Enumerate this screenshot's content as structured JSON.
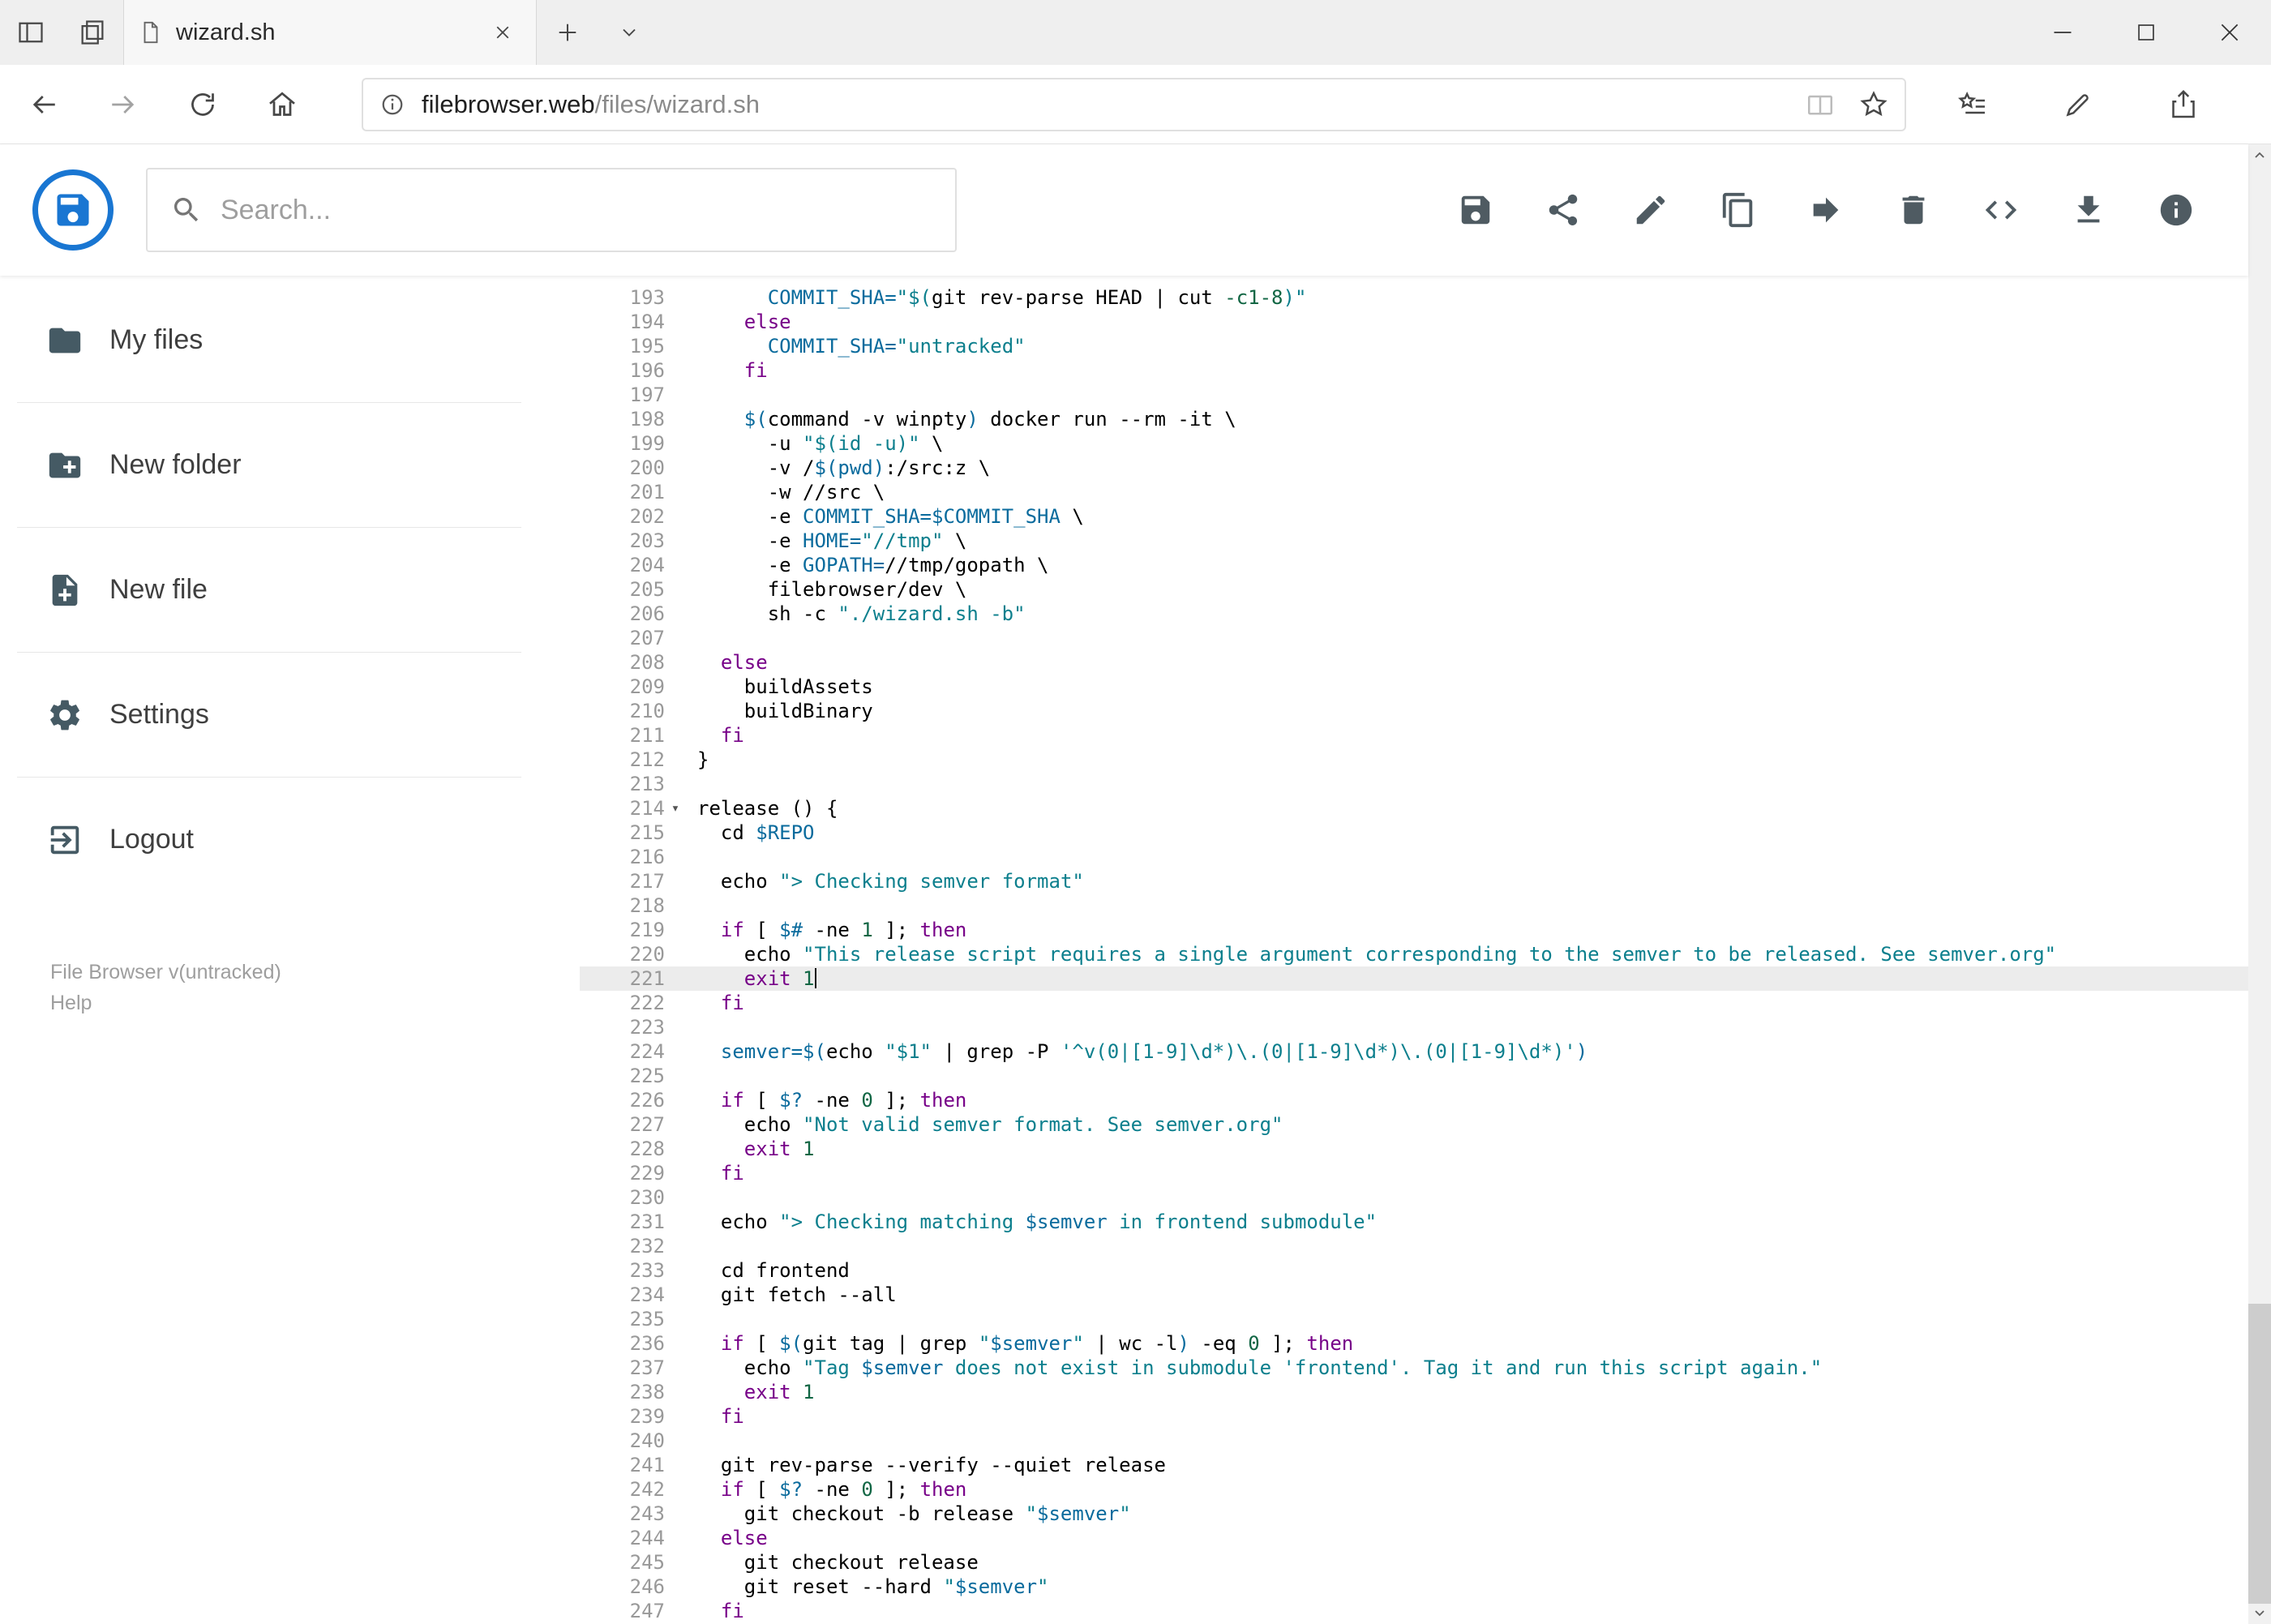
{
  "browser": {
    "tab_title": "wizard.sh",
    "url_domain": "filebrowser.web",
    "url_path": "/files/wizard.sh"
  },
  "app": {
    "search": {
      "placeholder": "Search..."
    },
    "toolbar_icons": [
      "save",
      "share",
      "rename",
      "copy",
      "move",
      "delete",
      "raw-view",
      "download",
      "info"
    ],
    "sidebar": {
      "items": [
        {
          "label": "My files",
          "icon": "folder-icon"
        },
        {
          "label": "New folder",
          "icon": "create-folder-icon"
        },
        {
          "label": "New file",
          "icon": "create-file-icon"
        },
        {
          "label": "Settings",
          "icon": "settings-icon"
        },
        {
          "label": "Logout",
          "icon": "logout-icon"
        }
      ],
      "version": "File Browser v(untracked)",
      "help": "Help"
    }
  },
  "editor": {
    "first_line": 193,
    "last_line": 247,
    "active_line": 221,
    "fold_line": 214,
    "fold_glyph": "▾",
    "accent_colors": {
      "keyword": "#770088",
      "string": "#0c7f8d",
      "variable": "#0a6b9d",
      "number": "#116644"
    },
    "lines": [
      {
        "n": 193,
        "t": [
          [
            "p",
            "      "
          ],
          [
            "v",
            "COMMIT_SHA="
          ],
          [
            "s",
            "\"$("
          ],
          [
            "p",
            "git rev-parse HEAD | cut "
          ],
          [
            "n",
            "-c1-8"
          ],
          [
            "s",
            ")\""
          ]
        ]
      },
      {
        "n": 194,
        "t": [
          [
            "p",
            "    "
          ],
          [
            "k",
            "else"
          ]
        ]
      },
      {
        "n": 195,
        "t": [
          [
            "p",
            "      "
          ],
          [
            "v",
            "COMMIT_SHA="
          ],
          [
            "s",
            "\"untracked\""
          ]
        ]
      },
      {
        "n": 196,
        "t": [
          [
            "p",
            "    "
          ],
          [
            "k",
            "fi"
          ]
        ]
      },
      {
        "n": 197,
        "t": []
      },
      {
        "n": 198,
        "t": [
          [
            "p",
            "    "
          ],
          [
            "v",
            "$("
          ],
          [
            "p",
            "command -v winpty"
          ],
          [
            "v",
            ")"
          ],
          [
            "p",
            " docker run --rm -it \\"
          ]
        ]
      },
      {
        "n": 199,
        "t": [
          [
            "p",
            "      -u "
          ],
          [
            "s",
            "\"$(id -u)\""
          ],
          [
            "p",
            " \\"
          ]
        ]
      },
      {
        "n": 200,
        "t": [
          [
            "p",
            "      -v /"
          ],
          [
            "v",
            "$(pwd)"
          ],
          [
            "p",
            ":/src:z \\"
          ]
        ]
      },
      {
        "n": 201,
        "t": [
          [
            "p",
            "      -w //src \\"
          ]
        ]
      },
      {
        "n": 202,
        "t": [
          [
            "p",
            "      -e "
          ],
          [
            "v",
            "COMMIT_SHA=$COMMIT_SHA"
          ],
          [
            "p",
            " \\"
          ]
        ]
      },
      {
        "n": 203,
        "t": [
          [
            "p",
            "      -e "
          ],
          [
            "v",
            "HOME="
          ],
          [
            "s",
            "\"//tmp\""
          ],
          [
            "p",
            " \\"
          ]
        ]
      },
      {
        "n": 204,
        "t": [
          [
            "p",
            "      -e "
          ],
          [
            "v",
            "GOPATH="
          ],
          [
            "p",
            "//tmp/gopath \\"
          ]
        ]
      },
      {
        "n": 205,
        "t": [
          [
            "p",
            "      filebrowser/dev \\"
          ]
        ]
      },
      {
        "n": 206,
        "t": [
          [
            "p",
            "      sh -c "
          ],
          [
            "s",
            "\"./wizard.sh -b\""
          ]
        ]
      },
      {
        "n": 207,
        "t": []
      },
      {
        "n": 208,
        "t": [
          [
            "p",
            "  "
          ],
          [
            "k",
            "else"
          ]
        ]
      },
      {
        "n": 209,
        "t": [
          [
            "p",
            "    buildAssets"
          ]
        ]
      },
      {
        "n": 210,
        "t": [
          [
            "p",
            "    buildBinary"
          ]
        ]
      },
      {
        "n": 211,
        "t": [
          [
            "p",
            "  "
          ],
          [
            "k",
            "fi"
          ]
        ]
      },
      {
        "n": 212,
        "t": [
          [
            "p",
            "}"
          ]
        ]
      },
      {
        "n": 213,
        "t": []
      },
      {
        "n": 214,
        "t": [
          [
            "p",
            "release () {"
          ]
        ]
      },
      {
        "n": 215,
        "t": [
          [
            "p",
            "  cd "
          ],
          [
            "v",
            "$REPO"
          ]
        ]
      },
      {
        "n": 216,
        "t": []
      },
      {
        "n": 217,
        "t": [
          [
            "p",
            "  echo "
          ],
          [
            "s",
            "\"> Checking semver format\""
          ]
        ]
      },
      {
        "n": 218,
        "t": []
      },
      {
        "n": 219,
        "t": [
          [
            "p",
            "  "
          ],
          [
            "k",
            "if"
          ],
          [
            "p",
            " [ "
          ],
          [
            "v",
            "$#"
          ],
          [
            "p",
            " -ne "
          ],
          [
            "n",
            "1"
          ],
          [
            "p",
            " ]; "
          ],
          [
            "k",
            "then"
          ]
        ]
      },
      {
        "n": 220,
        "t": [
          [
            "p",
            "    echo "
          ],
          [
            "s",
            "\"This release script requires a single argument corresponding to the semver to be released. See semver.org\""
          ]
        ]
      },
      {
        "n": 221,
        "t": [
          [
            "p",
            "    "
          ],
          [
            "k",
            "exit"
          ],
          [
            "p",
            " "
          ],
          [
            "n",
            "1"
          ]
        ]
      },
      {
        "n": 222,
        "t": [
          [
            "p",
            "  "
          ],
          [
            "k",
            "fi"
          ]
        ]
      },
      {
        "n": 223,
        "t": []
      },
      {
        "n": 224,
        "t": [
          [
            "p",
            "  "
          ],
          [
            "v",
            "semver=$("
          ],
          [
            "p",
            "echo "
          ],
          [
            "s",
            "\"$1\""
          ],
          [
            "p",
            " | grep -P "
          ],
          [
            "s",
            "'^v(0|[1-9]\\d*)\\.(0|[1-9]\\d*)\\.(0|[1-9]\\d*)'"
          ],
          [
            "v",
            ")"
          ]
        ]
      },
      {
        "n": 225,
        "t": []
      },
      {
        "n": 226,
        "t": [
          [
            "p",
            "  "
          ],
          [
            "k",
            "if"
          ],
          [
            "p",
            " [ "
          ],
          [
            "v",
            "$?"
          ],
          [
            "p",
            " -ne "
          ],
          [
            "n",
            "0"
          ],
          [
            "p",
            " ]; "
          ],
          [
            "k",
            "then"
          ]
        ]
      },
      {
        "n": 227,
        "t": [
          [
            "p",
            "    echo "
          ],
          [
            "s",
            "\"Not valid semver format. See semver.org\""
          ]
        ]
      },
      {
        "n": 228,
        "t": [
          [
            "p",
            "    "
          ],
          [
            "k",
            "exit"
          ],
          [
            "p",
            " "
          ],
          [
            "n",
            "1"
          ]
        ]
      },
      {
        "n": 229,
        "t": [
          [
            "p",
            "  "
          ],
          [
            "k",
            "fi"
          ]
        ]
      },
      {
        "n": 230,
        "t": []
      },
      {
        "n": 231,
        "t": [
          [
            "p",
            "  echo "
          ],
          [
            "s",
            "\"> Checking matching "
          ],
          [
            "v",
            "$semver"
          ],
          [
            "s",
            " in frontend submodule\""
          ]
        ]
      },
      {
        "n": 232,
        "t": []
      },
      {
        "n": 233,
        "t": [
          [
            "p",
            "  cd frontend"
          ]
        ]
      },
      {
        "n": 234,
        "t": [
          [
            "p",
            "  git fetch --all"
          ]
        ]
      },
      {
        "n": 235,
        "t": []
      },
      {
        "n": 236,
        "t": [
          [
            "p",
            "  "
          ],
          [
            "k",
            "if"
          ],
          [
            "p",
            " [ "
          ],
          [
            "v",
            "$("
          ],
          [
            "p",
            "git tag | grep "
          ],
          [
            "s",
            "\""
          ],
          [
            "v",
            "$semver"
          ],
          [
            "s",
            "\""
          ],
          [
            "p",
            " | wc -l"
          ],
          [
            "v",
            ")"
          ],
          [
            "p",
            " -eq "
          ],
          [
            "n",
            "0"
          ],
          [
            "p",
            " ]; "
          ],
          [
            "k",
            "then"
          ]
        ]
      },
      {
        "n": 237,
        "t": [
          [
            "p",
            "    echo "
          ],
          [
            "s",
            "\"Tag "
          ],
          [
            "v",
            "$semver"
          ],
          [
            "s",
            " does not exist in submodule 'frontend'. Tag it and run this script again.\""
          ]
        ]
      },
      {
        "n": 238,
        "t": [
          [
            "p",
            "    "
          ],
          [
            "k",
            "exit"
          ],
          [
            "p",
            " "
          ],
          [
            "n",
            "1"
          ]
        ]
      },
      {
        "n": 239,
        "t": [
          [
            "p",
            "  "
          ],
          [
            "k",
            "fi"
          ]
        ]
      },
      {
        "n": 240,
        "t": []
      },
      {
        "n": 241,
        "t": [
          [
            "p",
            "  git rev-parse --verify --quiet release"
          ]
        ]
      },
      {
        "n": 242,
        "t": [
          [
            "p",
            "  "
          ],
          [
            "k",
            "if"
          ],
          [
            "p",
            " [ "
          ],
          [
            "v",
            "$?"
          ],
          [
            "p",
            " -ne "
          ],
          [
            "n",
            "0"
          ],
          [
            "p",
            " ]; "
          ],
          [
            "k",
            "then"
          ]
        ]
      },
      {
        "n": 243,
        "t": [
          [
            "p",
            "    git checkout -b release "
          ],
          [
            "s",
            "\""
          ],
          [
            "v",
            "$semver"
          ],
          [
            "s",
            "\""
          ]
        ]
      },
      {
        "n": 244,
        "t": [
          [
            "p",
            "  "
          ],
          [
            "k",
            "else"
          ]
        ]
      },
      {
        "n": 245,
        "t": [
          [
            "p",
            "    git checkout release"
          ]
        ]
      },
      {
        "n": 246,
        "t": [
          [
            "p",
            "    git reset --hard "
          ],
          [
            "s",
            "\""
          ],
          [
            "v",
            "$semver"
          ],
          [
            "s",
            "\""
          ]
        ]
      },
      {
        "n": 247,
        "t": [
          [
            "p",
            "  "
          ],
          [
            "k",
            "fi"
          ]
        ]
      }
    ]
  }
}
